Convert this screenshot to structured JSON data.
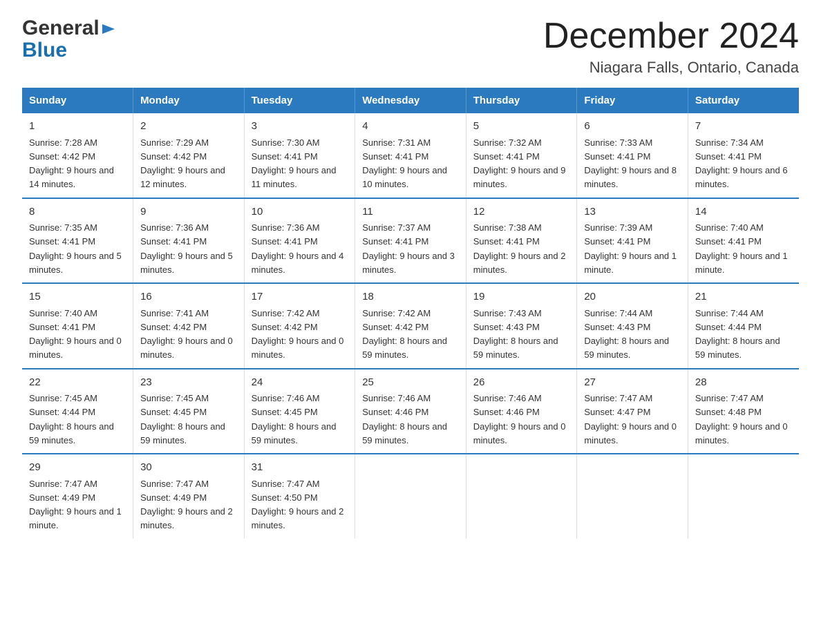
{
  "header": {
    "logo_general": "General",
    "logo_blue": "Blue",
    "month_title": "December 2024",
    "location": "Niagara Falls, Ontario, Canada"
  },
  "days_of_week": [
    "Sunday",
    "Monday",
    "Tuesday",
    "Wednesday",
    "Thursday",
    "Friday",
    "Saturday"
  ],
  "weeks": [
    [
      {
        "date": "1",
        "sunrise": "7:28 AM",
        "sunset": "4:42 PM",
        "daylight": "9 hours and 14 minutes."
      },
      {
        "date": "2",
        "sunrise": "7:29 AM",
        "sunset": "4:42 PM",
        "daylight": "9 hours and 12 minutes."
      },
      {
        "date": "3",
        "sunrise": "7:30 AM",
        "sunset": "4:41 PM",
        "daylight": "9 hours and 11 minutes."
      },
      {
        "date": "4",
        "sunrise": "7:31 AM",
        "sunset": "4:41 PM",
        "daylight": "9 hours and 10 minutes."
      },
      {
        "date": "5",
        "sunrise": "7:32 AM",
        "sunset": "4:41 PM",
        "daylight": "9 hours and 9 minutes."
      },
      {
        "date": "6",
        "sunrise": "7:33 AM",
        "sunset": "4:41 PM",
        "daylight": "9 hours and 8 minutes."
      },
      {
        "date": "7",
        "sunrise": "7:34 AM",
        "sunset": "4:41 PM",
        "daylight": "9 hours and 6 minutes."
      }
    ],
    [
      {
        "date": "8",
        "sunrise": "7:35 AM",
        "sunset": "4:41 PM",
        "daylight": "9 hours and 5 minutes."
      },
      {
        "date": "9",
        "sunrise": "7:36 AM",
        "sunset": "4:41 PM",
        "daylight": "9 hours and 5 minutes."
      },
      {
        "date": "10",
        "sunrise": "7:36 AM",
        "sunset": "4:41 PM",
        "daylight": "9 hours and 4 minutes."
      },
      {
        "date": "11",
        "sunrise": "7:37 AM",
        "sunset": "4:41 PM",
        "daylight": "9 hours and 3 minutes."
      },
      {
        "date": "12",
        "sunrise": "7:38 AM",
        "sunset": "4:41 PM",
        "daylight": "9 hours and 2 minutes."
      },
      {
        "date": "13",
        "sunrise": "7:39 AM",
        "sunset": "4:41 PM",
        "daylight": "9 hours and 1 minute."
      },
      {
        "date": "14",
        "sunrise": "7:40 AM",
        "sunset": "4:41 PM",
        "daylight": "9 hours and 1 minute."
      }
    ],
    [
      {
        "date": "15",
        "sunrise": "7:40 AM",
        "sunset": "4:41 PM",
        "daylight": "9 hours and 0 minutes."
      },
      {
        "date": "16",
        "sunrise": "7:41 AM",
        "sunset": "4:42 PM",
        "daylight": "9 hours and 0 minutes."
      },
      {
        "date": "17",
        "sunrise": "7:42 AM",
        "sunset": "4:42 PM",
        "daylight": "9 hours and 0 minutes."
      },
      {
        "date": "18",
        "sunrise": "7:42 AM",
        "sunset": "4:42 PM",
        "daylight": "8 hours and 59 minutes."
      },
      {
        "date": "19",
        "sunrise": "7:43 AM",
        "sunset": "4:43 PM",
        "daylight": "8 hours and 59 minutes."
      },
      {
        "date": "20",
        "sunrise": "7:44 AM",
        "sunset": "4:43 PM",
        "daylight": "8 hours and 59 minutes."
      },
      {
        "date": "21",
        "sunrise": "7:44 AM",
        "sunset": "4:44 PM",
        "daylight": "8 hours and 59 minutes."
      }
    ],
    [
      {
        "date": "22",
        "sunrise": "7:45 AM",
        "sunset": "4:44 PM",
        "daylight": "8 hours and 59 minutes."
      },
      {
        "date": "23",
        "sunrise": "7:45 AM",
        "sunset": "4:45 PM",
        "daylight": "8 hours and 59 minutes."
      },
      {
        "date": "24",
        "sunrise": "7:46 AM",
        "sunset": "4:45 PM",
        "daylight": "8 hours and 59 minutes."
      },
      {
        "date": "25",
        "sunrise": "7:46 AM",
        "sunset": "4:46 PM",
        "daylight": "8 hours and 59 minutes."
      },
      {
        "date": "26",
        "sunrise": "7:46 AM",
        "sunset": "4:46 PM",
        "daylight": "9 hours and 0 minutes."
      },
      {
        "date": "27",
        "sunrise": "7:47 AM",
        "sunset": "4:47 PM",
        "daylight": "9 hours and 0 minutes."
      },
      {
        "date": "28",
        "sunrise": "7:47 AM",
        "sunset": "4:48 PM",
        "daylight": "9 hours and 0 minutes."
      }
    ],
    [
      {
        "date": "29",
        "sunrise": "7:47 AM",
        "sunset": "4:49 PM",
        "daylight": "9 hours and 1 minute."
      },
      {
        "date": "30",
        "sunrise": "7:47 AM",
        "sunset": "4:49 PM",
        "daylight": "9 hours and 2 minutes."
      },
      {
        "date": "31",
        "sunrise": "7:47 AM",
        "sunset": "4:50 PM",
        "daylight": "9 hours and 2 minutes."
      },
      null,
      null,
      null,
      null
    ]
  ],
  "labels": {
    "sunrise": "Sunrise:",
    "sunset": "Sunset:",
    "daylight": "Daylight:"
  }
}
